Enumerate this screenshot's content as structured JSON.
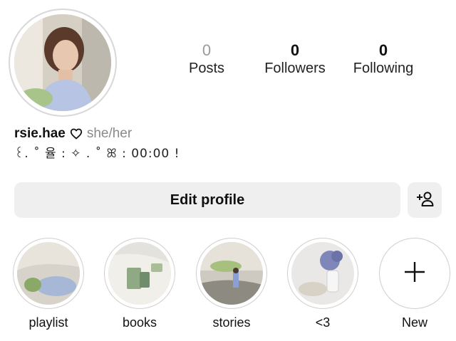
{
  "profile": {
    "username": "rsie.hae",
    "pronouns": "she/her",
    "bio": "꒰. ˚ 율 : ✧ . ˚ ꕤ : 00:00 !"
  },
  "stats": [
    {
      "count": "0",
      "label": "Posts"
    },
    {
      "count": "0",
      "label": "Followers"
    },
    {
      "count": "0",
      "label": "Following"
    }
  ],
  "actions": {
    "edit_profile_label": "Edit profile",
    "add_person_icon": "add-person-icon"
  },
  "highlights": [
    {
      "label": "playlist"
    },
    {
      "label": "books"
    },
    {
      "label": "stories"
    },
    {
      "label": "<3"
    },
    {
      "label": "New",
      "icon": "plus-icon"
    }
  ],
  "colors": {
    "button_bg": "#efefef",
    "ring": "#d8d8d8",
    "muted_text": "#8a8a8a"
  }
}
